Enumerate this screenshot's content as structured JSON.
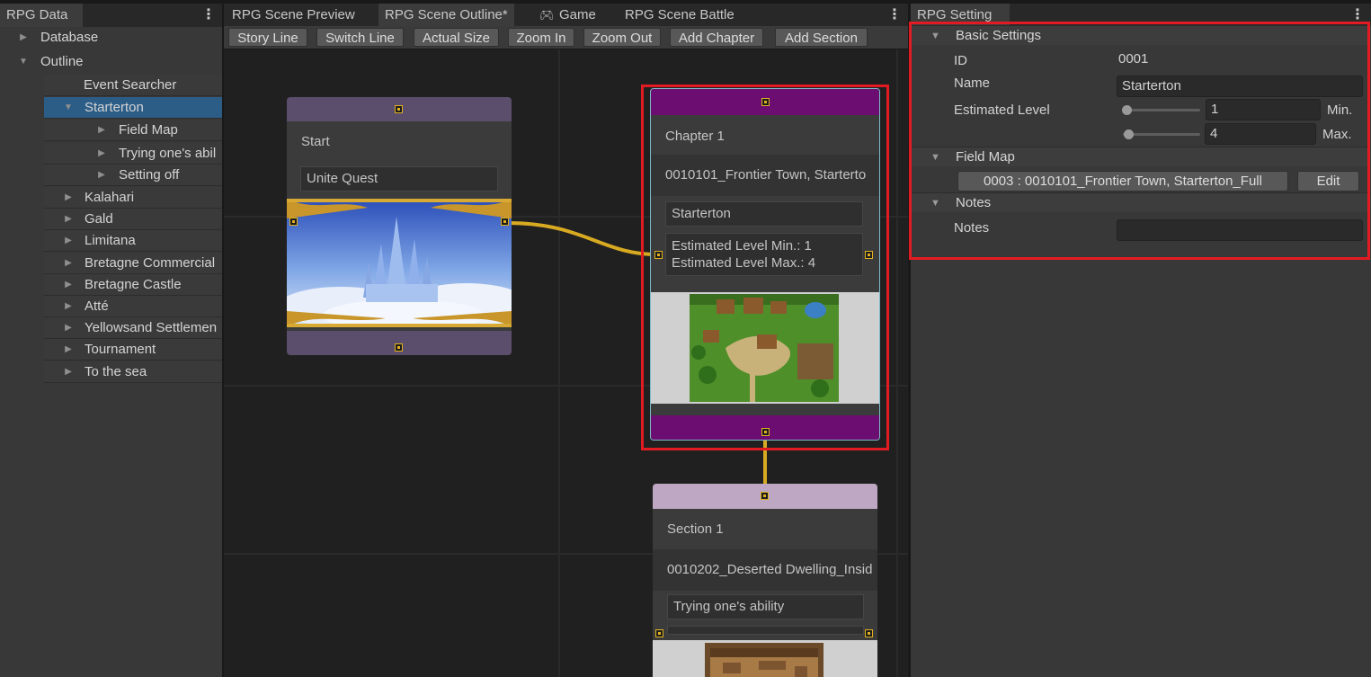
{
  "left_panel": {
    "tab": "RPG Data",
    "tree": {
      "database": "Database",
      "outline": "Outline",
      "event_searcher": "Event Searcher",
      "items": [
        {
          "label": "Starterton",
          "children": [
            "Field Map",
            "Trying one's abil",
            "Setting off"
          ]
        },
        {
          "label": "Kalahari"
        },
        {
          "label": "Gald"
        },
        {
          "label": "Limitana"
        },
        {
          "label": "Bretagne Commercial"
        },
        {
          "label": "Bretagne Castle"
        },
        {
          "label": "Atté"
        },
        {
          "label": "Yellowsand Settlemen"
        },
        {
          "label": "Tournament"
        },
        {
          "label": "To the sea"
        }
      ]
    }
  },
  "center_panel": {
    "tabs": [
      "RPG Scene Preview",
      "RPG Scene Outline*",
      "Game",
      "RPG Scene Battle"
    ],
    "toolbar": [
      "Story Line",
      "Switch Line",
      "Actual Size",
      "Zoom In",
      "Zoom Out",
      "Add Chapter",
      "Add Section"
    ],
    "nodes": {
      "start": {
        "title": "Start",
        "field": "Unite Quest",
        "band_color": "#5b4e6c"
      },
      "chapter": {
        "title": "Chapter 1",
        "map_name": "0010101_Frontier Town, Starterto",
        "field": "Starterton",
        "level_min": "Estimated Level Min.: 1",
        "level_max": "Estimated Level Max.: 4",
        "band_color": "#6c0d72"
      },
      "section": {
        "title": "Section 1",
        "map_name": "0010202_Deserted Dwelling_Insid",
        "field": "Trying one's ability",
        "band_color": "#bea7c2"
      }
    },
    "connection_color": "#d8aa22"
  },
  "right_panel": {
    "tab": "RPG Setting",
    "basic_settings": {
      "header": "Basic Settings",
      "id_label": "ID",
      "id_value": "0001",
      "name_label": "Name",
      "name_value": "Starterton",
      "level_label": "Estimated Level",
      "level_min": "1",
      "level_min_label": "Min.",
      "level_max": "4",
      "level_max_label": "Max."
    },
    "field_map": {
      "header": "Field Map",
      "value": "0003 : 0010101_Frontier Town, Starterton_Full",
      "edit_label": "Edit"
    },
    "notes": {
      "header": "Notes",
      "label": "Notes",
      "value": ""
    }
  },
  "colors": {
    "highlight": "#e21b23",
    "selected_row": "#2c5d87",
    "port": "#e0b020"
  }
}
